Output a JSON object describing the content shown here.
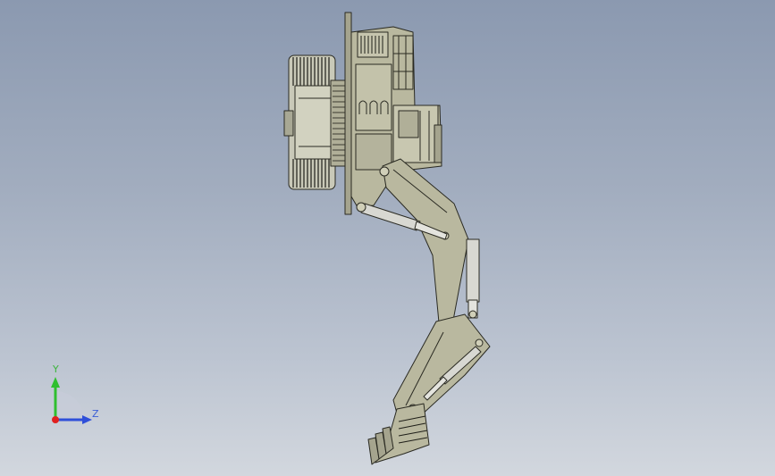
{
  "viewport": {
    "background_top": "#8b99b0",
    "background_bottom": "#d2d7de",
    "model_color": "#b9b89f",
    "model_edge_color": "#2a2a22",
    "cylinder_color": "#d8d8d2"
  },
  "triad": {
    "y_label": "Y",
    "z_label": "Z",
    "y_color": "#2fbf2f",
    "z_color": "#2f4fd9",
    "x_color": "#e02020"
  },
  "icons": [
    "orientation-triad-icon"
  ]
}
